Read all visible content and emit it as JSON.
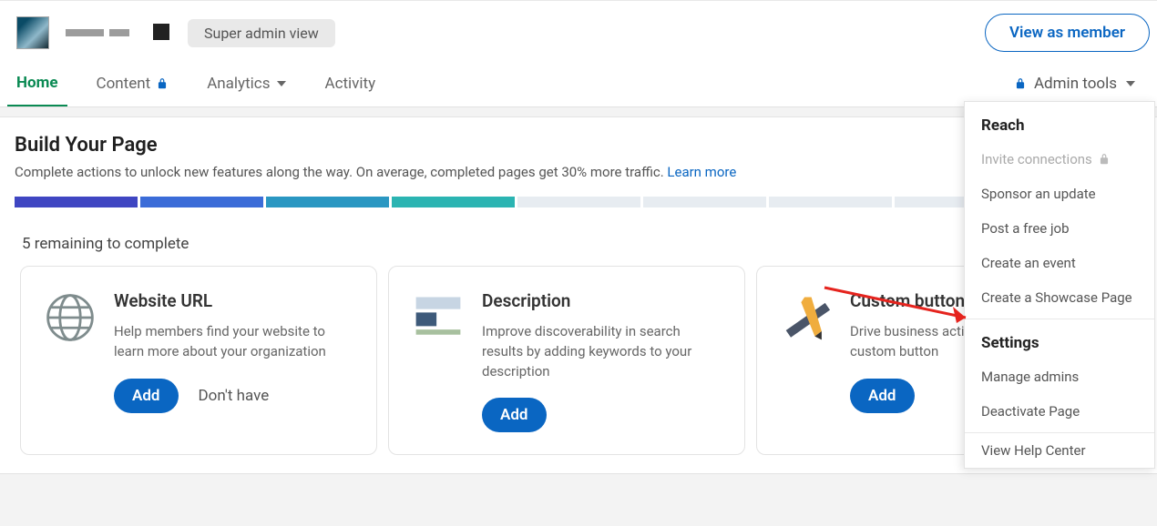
{
  "header": {
    "badge_label": "Super admin view",
    "view_as_member": "View as member"
  },
  "tabs": {
    "home": "Home",
    "content": "Content",
    "analytics": "Analytics",
    "activity": "Activity",
    "admin_tools": "Admin tools"
  },
  "panel": {
    "title": "Build Your Page",
    "subtitle": "Complete actions to unlock new features along the way. On average, completed pages get 30% more traffic. ",
    "learn_more": "Learn more",
    "remaining": "5 remaining to complete"
  },
  "cards": [
    {
      "title": "Website URL",
      "desc": "Help members find your website to learn more about your organization",
      "add": "Add",
      "secondary": "Don't have"
    },
    {
      "title": "Description",
      "desc": "Improve discoverability in search results by adding keywords to your description",
      "add": "Add",
      "secondary": ""
    },
    {
      "title": "Custom button",
      "desc": "Drive business actions by adding a custom button",
      "add": "Add",
      "secondary": ""
    }
  ],
  "dropdown": {
    "section1": "Reach",
    "items1": [
      "Invite connections",
      "Sponsor an update",
      "Post a free job",
      "Create an event",
      "Create a Showcase Page"
    ],
    "section2": "Settings",
    "items2": [
      "Manage admins",
      "Deactivate Page",
      "View Help Center"
    ]
  }
}
